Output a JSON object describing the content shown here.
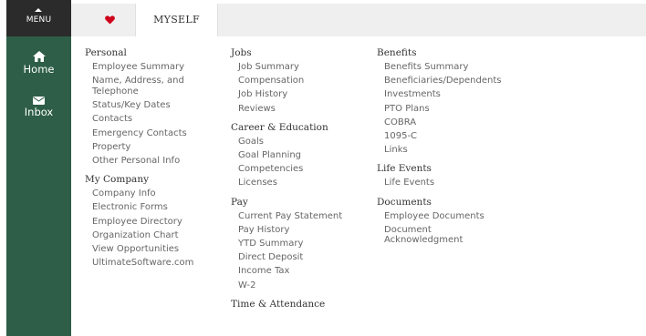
{
  "sidebar": {
    "menu_label": "MENU",
    "items": [
      {
        "label": "Home",
        "icon": "home-icon"
      },
      {
        "label": "Inbox",
        "icon": "envelope-icon"
      }
    ],
    "background": "#2e5e47"
  },
  "tabs": {
    "favorites_icon": "heart-icon",
    "favorites_color": "#d0021b",
    "active_label": "MYSELF"
  },
  "columns": [
    {
      "sections": [
        {
          "title": "Personal",
          "links": [
            "Employee Summary",
            "Name, Address, and Telephone",
            "Status/Key Dates",
            "Contacts",
            "Emergency Contacts",
            "Property",
            "Other Personal Info"
          ]
        },
        {
          "title": "My Company",
          "links": [
            "Company Info",
            "Electronic Forms",
            "Employee Directory",
            "Organization Chart",
            "View Opportunities",
            "UltimateSoftware.com"
          ]
        }
      ]
    },
    {
      "sections": [
        {
          "title": "Jobs",
          "links": [
            "Job Summary",
            "Compensation",
            "Job History",
            "Reviews"
          ]
        },
        {
          "title": "Career & Education",
          "links": [
            "Goals",
            "Goal Planning",
            "Competencies",
            "Licenses"
          ]
        },
        {
          "title": "Pay",
          "links": [
            "Current Pay Statement",
            "Pay History",
            "YTD Summary",
            "Direct Deposit",
            "Income Tax",
            "W-2"
          ]
        },
        {
          "title": "Time & Attendance",
          "links": []
        }
      ]
    },
    {
      "sections": [
        {
          "title": "Benefits",
          "links": [
            "Benefits Summary",
            "Beneficiaries/Dependents",
            "Investments",
            "PTO Plans",
            "COBRA",
            "1095-C",
            "Links"
          ]
        },
        {
          "title": "Life Events",
          "links": [
            "Life Events"
          ]
        },
        {
          "title": "Documents",
          "links": [
            "Employee Documents",
            "Document Acknowledgment"
          ]
        }
      ]
    }
  ]
}
